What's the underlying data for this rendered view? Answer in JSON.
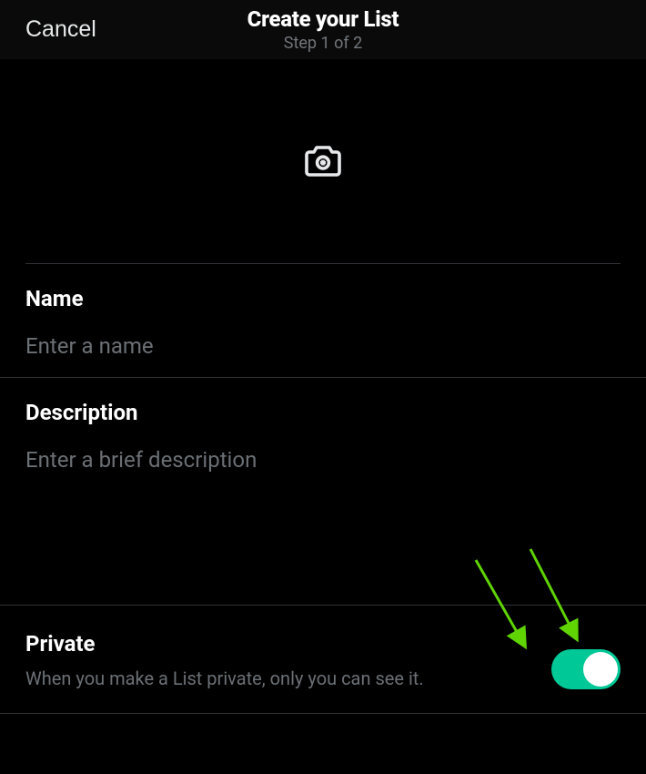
{
  "header": {
    "cancel_label": "Cancel",
    "title": "Create your List",
    "subtitle": "Step 1 of 2"
  },
  "form": {
    "name_label": "Name",
    "name_placeholder": "Enter a name",
    "name_value": "",
    "description_label": "Description",
    "description_placeholder": "Enter a brief description",
    "description_value": ""
  },
  "privacy": {
    "title": "Private",
    "description": "When you make a List private, only you can see it.",
    "toggle_on": true
  },
  "colors": {
    "toggle_active": "#00c896",
    "annotation_arrow": "#5fd402"
  }
}
